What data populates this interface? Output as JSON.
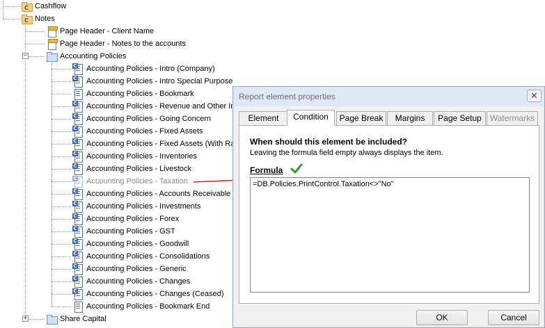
{
  "tree": {
    "nodes": [
      {
        "label": "Cashflow"
      },
      {
        "label": "Notes"
      },
      {
        "label": "Page Header - Client Name"
      },
      {
        "label": "Page Header - Notes to the accounts"
      },
      {
        "label": "Accounting Policies"
      },
      {
        "label": "Accounting Policies - Intro (Company)"
      },
      {
        "label": "Accounting Policies - Intro Special Purpose"
      },
      {
        "label": "Accounting Policies - Bookmark"
      },
      {
        "label": "Accounting Policies - Revenue and Other In"
      },
      {
        "label": "Accounting Policies - Going Concern"
      },
      {
        "label": "Accounting Policies - Fixed Assets"
      },
      {
        "label": "Accounting Policies - Fixed Assets (With Rat"
      },
      {
        "label": "Accounting Policies - Inventories"
      },
      {
        "label": "Accounting Policies - Livestock"
      },
      {
        "label": "Accounting Policies - Taxation"
      },
      {
        "label": "Accounting Policies - Accounts Receivable"
      },
      {
        "label": "Accounting Policies - Investments"
      },
      {
        "label": "Accounting Policies - Forex"
      },
      {
        "label": "Accounting Policies - GST"
      },
      {
        "label": "Accounting Policies - Goodwill"
      },
      {
        "label": "Accounting Policies - Consolidations"
      },
      {
        "label": "Accounting Policies - Generic"
      },
      {
        "label": "Accounting Policies - Changes"
      },
      {
        "label": "Accounting Policies - Changes (Ceased)"
      },
      {
        "label": "Accounting Policies - Bookmark End"
      },
      {
        "label": "Share Capital"
      }
    ],
    "expander_collapsed": "+",
    "expander_expanded": "−",
    "icon_letter": "C"
  },
  "dialog": {
    "title": "Report element properties",
    "close_glyph": "✕",
    "tabs": [
      {
        "label": "Element"
      },
      {
        "label": "Condition"
      },
      {
        "label": "Page Break"
      },
      {
        "label": "Margins"
      },
      {
        "label": "Page Setup"
      },
      {
        "label": "Watermarks"
      }
    ],
    "active_tab": "Condition",
    "question": "When should this element be included?",
    "hint": "Leaving the formula field empty always displays the item.",
    "formula_label": "Formula",
    "formula_value": "=DB.Policies.PrintControl.Taxation<>\"No\"",
    "ok_label": "OK",
    "cancel_label": "Cancel"
  },
  "colors": {
    "arrow": "#e02020",
    "check": "#2e9e2e",
    "title_bar": "#dfe9f5"
  }
}
